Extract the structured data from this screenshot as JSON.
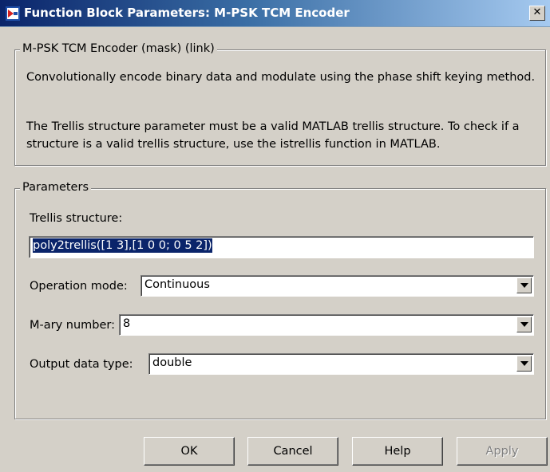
{
  "window": {
    "title": "Function Block Parameters: M-PSK TCM Encoder",
    "close_glyph": "✕"
  },
  "mask": {
    "legend": "M-PSK TCM Encoder (mask) (link)",
    "description_1": "Convolutionally encode binary data and modulate using the phase shift keying method.",
    "description_2": "The Trellis structure parameter must be a valid MATLAB trellis structure. To check if a structure is a valid trellis structure, use the istrellis function in MATLAB."
  },
  "parameters": {
    "legend": "Parameters",
    "trellis": {
      "label": "Trellis structure:",
      "value": "poly2trellis([1 3],[1 0 0; 0 5 2])"
    },
    "operation_mode": {
      "label": "Operation mode:",
      "value": "Continuous"
    },
    "mary_number": {
      "label": "M-ary number:",
      "value": "8"
    },
    "output_data_type": {
      "label": "Output data type:",
      "value": "double"
    }
  },
  "buttons": {
    "ok": "OK",
    "cancel": "Cancel",
    "help": "Help",
    "apply": "Apply"
  },
  "icons": {
    "window": "simulink-block-icon",
    "close": "close-icon",
    "dropdown": "chevron-down-icon"
  }
}
